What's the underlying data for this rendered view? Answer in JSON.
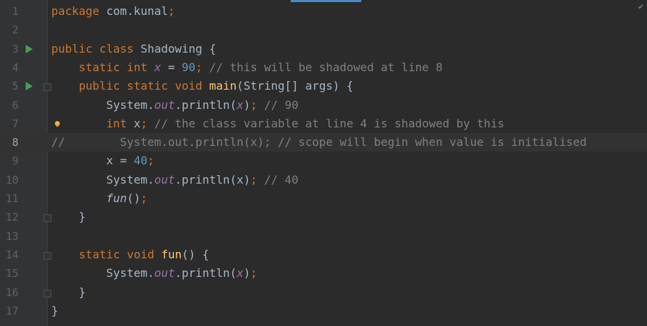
{
  "editor": {
    "file_language": "Java",
    "lines": [
      {
        "n": "1",
        "tokens": [
          [
            "package",
            "kw"
          ],
          [
            " com.kunal",
            "cls"
          ],
          [
            ";",
            "kw"
          ]
        ]
      },
      {
        "n": "2",
        "tokens": []
      },
      {
        "n": "3",
        "tokens": [
          [
            "public class ",
            "kw"
          ],
          [
            "Shadowing {",
            "cls"
          ]
        ]
      },
      {
        "n": "4",
        "tokens": [
          [
            "    static int ",
            "kw"
          ],
          [
            "x",
            "st"
          ],
          [
            " = ",
            "cls"
          ],
          [
            "90",
            "num"
          ],
          [
            ";",
            "kw"
          ],
          [
            " // this will be shadowed at line 8",
            "cm"
          ]
        ]
      },
      {
        "n": "5",
        "tokens": [
          [
            "    public static void ",
            "kw"
          ],
          [
            "main",
            "fn"
          ],
          [
            "(String[] args) {",
            "cls"
          ]
        ]
      },
      {
        "n": "6",
        "tokens": [
          [
            "        System.",
            "cls"
          ],
          [
            "out",
            "st"
          ],
          [
            ".println(",
            "cls"
          ],
          [
            "x",
            "st"
          ],
          [
            ")",
            "cls"
          ],
          [
            ";",
            "kw"
          ],
          [
            " // 90",
            "cm"
          ]
        ]
      },
      {
        "n": "7",
        "tokens": [
          [
            "        int ",
            "kw"
          ],
          [
            "x",
            "cls"
          ],
          [
            ";",
            "kw"
          ],
          [
            " // the class variable at line 4 is shadowed by this",
            "cm"
          ]
        ]
      },
      {
        "n": "8",
        "tokens": [
          [
            "//        System.out.println(x); // scope will begin when value is initialised",
            "cm"
          ]
        ]
      },
      {
        "n": "9",
        "tokens": [
          [
            "        x = ",
            "cls"
          ],
          [
            "40",
            "num"
          ],
          [
            ";",
            "kw"
          ]
        ]
      },
      {
        "n": "10",
        "tokens": [
          [
            "        System.",
            "cls"
          ],
          [
            "out",
            "st"
          ],
          [
            ".println(x)",
            "cls"
          ],
          [
            ";",
            "kw"
          ],
          [
            " // 40",
            "cm"
          ]
        ]
      },
      {
        "n": "11",
        "tokens": [
          [
            "        ",
            "cls"
          ],
          [
            "fun",
            "it"
          ],
          [
            "()",
            "cls"
          ],
          [
            ";",
            "kw"
          ]
        ]
      },
      {
        "n": "12",
        "tokens": [
          [
            "    }",
            "cls"
          ]
        ]
      },
      {
        "n": "13",
        "tokens": []
      },
      {
        "n": "14",
        "tokens": [
          [
            "    static void ",
            "kw"
          ],
          [
            "fun",
            "fn"
          ],
          [
            "() {",
            "cls"
          ]
        ]
      },
      {
        "n": "15",
        "tokens": [
          [
            "        System.",
            "cls"
          ],
          [
            "out",
            "st"
          ],
          [
            ".println(",
            "cls"
          ],
          [
            "x",
            "st"
          ],
          [
            ")",
            "cls"
          ],
          [
            ";",
            "kw"
          ]
        ]
      },
      {
        "n": "16",
        "tokens": [
          [
            "    }",
            "cls"
          ]
        ]
      },
      {
        "n": "17",
        "tokens": [
          [
            "}",
            "cls"
          ]
        ]
      }
    ],
    "active_line": "8",
    "run_markers": [
      "3",
      "5"
    ],
    "fold_markers": [
      "5",
      "12",
      "14",
      "16"
    ],
    "intention_bulb_line": "7"
  },
  "colors": {
    "background": "#2b2b2b",
    "gutter": "#313335",
    "keyword": "#cc7832",
    "number": "#6897bb",
    "comment": "#808080",
    "static_field": "#9876aa",
    "method": "#ffc66d",
    "run_marker": "#499c54"
  },
  "status": {
    "check_icon": "check-icon"
  }
}
